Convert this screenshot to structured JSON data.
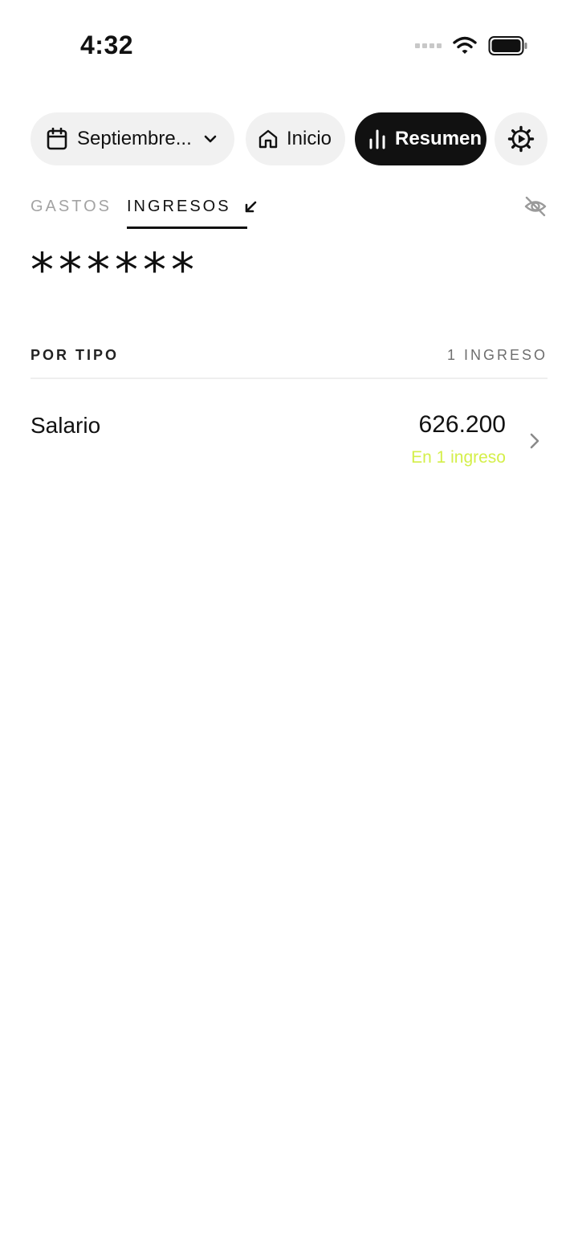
{
  "status_bar": {
    "time": "4:32"
  },
  "nav": {
    "month_label": "Septiembre...",
    "home_label": "Inicio",
    "summary_label": "Resumen"
  },
  "tabs": [
    {
      "label": "GASTOS",
      "active": false
    },
    {
      "label": "INGRESOS",
      "active": true
    }
  ],
  "total": {
    "hidden_value": "******"
  },
  "section": {
    "title": "POR TIPO",
    "count": "1 INGRESO"
  },
  "rows": [
    {
      "name": "Salario",
      "amount": "626.200",
      "subtitle": "En 1 ingreso"
    }
  ],
  "colors": {
    "accent_green": "#d4ef4a",
    "active_pill": "#111111",
    "pill_bg": "#f1f1f1",
    "muted_text": "#a3a3a3"
  },
  "icons": {
    "calendar": "calendar-icon",
    "chevron_down": "chevron-down-icon",
    "home": "home-icon",
    "bar_chart": "bar-chart-icon",
    "settings": "gear-icon",
    "arrow": "arrow-down-left-icon",
    "eye_off": "eye-off-icon",
    "chevron_right": "chevron-right-icon"
  }
}
